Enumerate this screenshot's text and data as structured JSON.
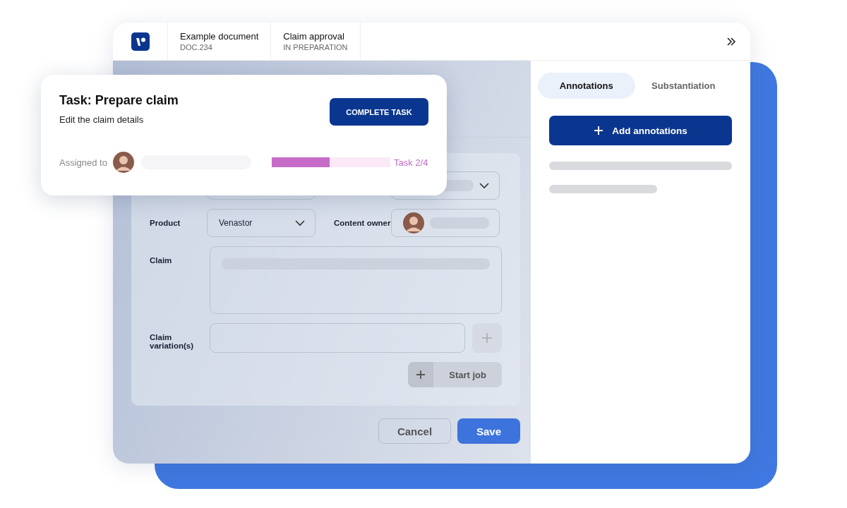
{
  "header": {
    "documents": [
      {
        "title": "Example document",
        "subtitle": "DOC.234"
      },
      {
        "title": "Claim approval",
        "subtitle": "IN PREPARATION"
      }
    ]
  },
  "task_card": {
    "title": "Task: Prepare claim",
    "description": "Edit the claim details",
    "button": "COMPLETE TASK",
    "assigned_label": "Assigned to",
    "progress": {
      "level": 0.49,
      "reading": "Task 2/4"
    }
  },
  "form": {
    "rows": [
      {
        "fields": [
          {
            "kind": "input"
          },
          {
            "kind": "select"
          }
        ]
      },
      {
        "fields": [
          {
            "kind": "select",
            "label": "Product",
            "value": "Venastor"
          },
          {
            "kind": "person",
            "label": "Content owner"
          }
        ]
      },
      {
        "fields": [
          {
            "kind": "textarea",
            "label": "Claim"
          }
        ]
      },
      {
        "fields": [
          {
            "kind": "add-input",
            "label": "Claim variation(s)"
          }
        ]
      }
    ],
    "start_job": "Start job"
  },
  "actions": {
    "cancel": "Cancel",
    "save": "Save"
  },
  "side_panel": {
    "tabs": [
      {
        "label": "Annotations",
        "selected": true
      },
      {
        "label": "Substantiation",
        "selected": false
      }
    ],
    "add_button": "Add annotations"
  }
}
